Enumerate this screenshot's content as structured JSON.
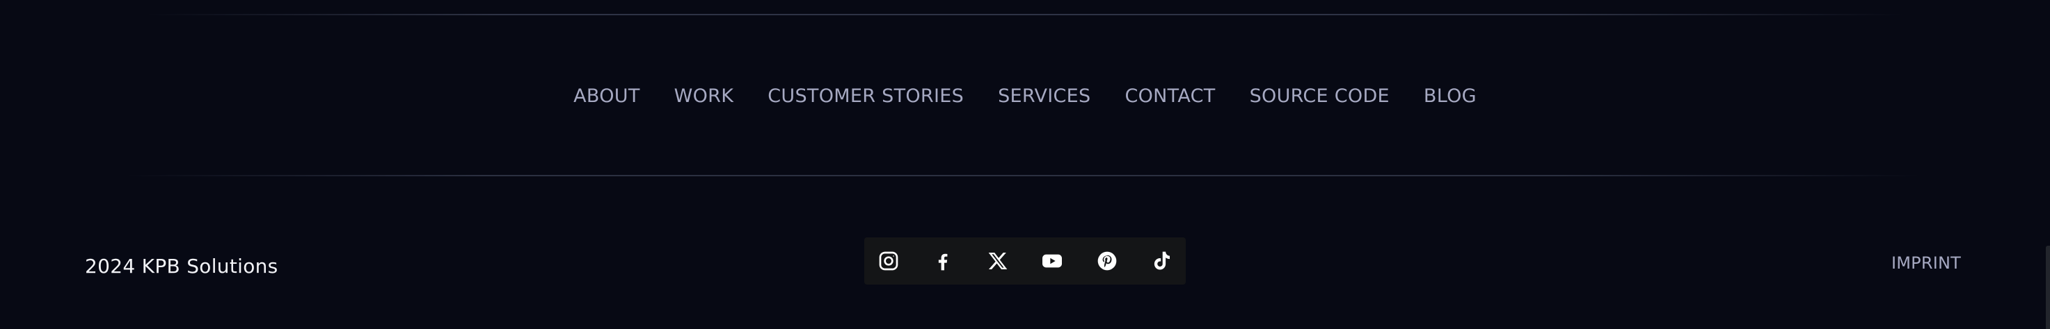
{
  "nav": {
    "items": [
      {
        "label": "ABOUT"
      },
      {
        "label": "WORK"
      },
      {
        "label": "CUSTOMER STORIES"
      },
      {
        "label": "SERVICES"
      },
      {
        "label": "CONTACT"
      },
      {
        "label": "SOURCE CODE"
      },
      {
        "label": "BLOG"
      }
    ]
  },
  "footer": {
    "copyright": "2024 KPB Solutions",
    "imprint_label": "IMPRINT",
    "social": [
      {
        "icon": "instagram-icon"
      },
      {
        "icon": "facebook-icon"
      },
      {
        "icon": "x-icon"
      },
      {
        "icon": "youtube-icon"
      },
      {
        "icon": "pinterest-icon"
      },
      {
        "icon": "tiktok-icon"
      }
    ]
  },
  "colors": {
    "background": "#070914",
    "nav_text": "#a6a9c2",
    "social_bar": "#141517",
    "icon": "#ffffff"
  }
}
